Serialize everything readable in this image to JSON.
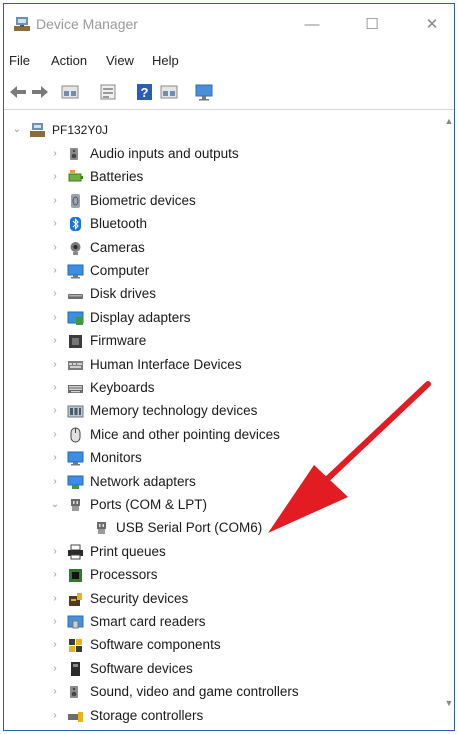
{
  "window": {
    "title": "Device Manager",
    "minimize_glyph": "—",
    "maximize_glyph": "☐",
    "close_glyph": "✕"
  },
  "menu": [
    "File",
    "Action",
    "View",
    "Help"
  ],
  "toolbar": {
    "icons": [
      "back-icon",
      "forward-icon",
      "properties-view-icon",
      "device-list-icon",
      "help-icon",
      "view-options-icon",
      "scan-hardware-icon"
    ]
  },
  "tree": {
    "root": {
      "label": "PF132Y0J",
      "expanded": true
    },
    "categories": [
      {
        "label": "Audio inputs and outputs",
        "icon": "speaker-icon"
      },
      {
        "label": "Batteries",
        "icon": "battery-icon"
      },
      {
        "label": "Biometric devices",
        "icon": "fingerprint-icon"
      },
      {
        "label": "Bluetooth",
        "icon": "bluetooth-icon"
      },
      {
        "label": "Cameras",
        "icon": "camera-icon"
      },
      {
        "label": "Computer",
        "icon": "computer-icon"
      },
      {
        "label": "Disk drives",
        "icon": "disk-drive-icon"
      },
      {
        "label": "Display adapters",
        "icon": "display-adapter-icon"
      },
      {
        "label": "Firmware",
        "icon": "firmware-icon"
      },
      {
        "label": "Human Interface Devices",
        "icon": "hid-icon"
      },
      {
        "label": "Keyboards",
        "icon": "keyboard-icon"
      },
      {
        "label": "Memory technology devices",
        "icon": "memory-icon"
      },
      {
        "label": "Mice and other pointing devices",
        "icon": "mouse-icon"
      },
      {
        "label": "Monitors",
        "icon": "monitor-icon"
      },
      {
        "label": "Network adapters",
        "icon": "network-adapter-icon"
      },
      {
        "label": "Ports (COM & LPT)",
        "icon": "port-icon",
        "expanded": true,
        "children": [
          {
            "label": "USB Serial Port (COM6)",
            "icon": "port-icon"
          }
        ]
      },
      {
        "label": "Print queues",
        "icon": "printer-icon"
      },
      {
        "label": "Processors",
        "icon": "processor-icon"
      },
      {
        "label": "Security devices",
        "icon": "security-icon"
      },
      {
        "label": "Smart card readers",
        "icon": "smart-card-icon"
      },
      {
        "label": "Software components",
        "icon": "software-component-icon"
      },
      {
        "label": "Software devices",
        "icon": "software-device-icon"
      },
      {
        "label": "Sound, video and game controllers",
        "icon": "sound-controller-icon"
      },
      {
        "label": "Storage controllers",
        "icon": "storage-controller-icon"
      }
    ]
  },
  "colors": {
    "annotation_arrow": "#e31b23",
    "window_border": "#2b5fb3"
  }
}
